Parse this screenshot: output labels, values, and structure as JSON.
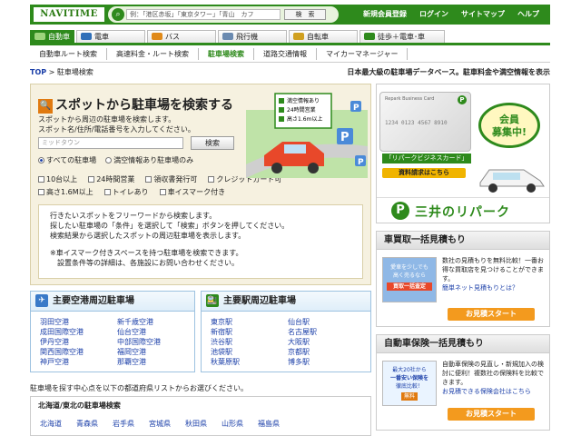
{
  "header": {
    "logo": "NAVITIME",
    "search_placeholder": "例：「港区赤坂」「東京タワー」「青山　カフ",
    "search_button": "検　索",
    "nav": [
      "新規会員登録",
      "ログイン",
      "サイトマップ",
      "ヘルプ"
    ]
  },
  "tabs": [
    {
      "label": "自動車",
      "active": true,
      "color": "#4a9a2a"
    },
    {
      "label": "電車",
      "active": false,
      "color": "#2f6fb8"
    },
    {
      "label": "バス",
      "active": false,
      "color": "#e08a1a"
    },
    {
      "label": "飛行機",
      "active": false,
      "color": "#6a8ab0"
    },
    {
      "label": "自転車",
      "active": false,
      "color": "#d0a020"
    },
    {
      "label": "徒歩＋電車･車",
      "active": false,
      "color": "#2e8a1c"
    }
  ],
  "subnav": [
    "自動車ルート検索",
    "高速料金・ルート検索",
    "駐車場検索",
    "道路交通情報",
    "マイカーマネージャー"
  ],
  "breadcrumb": {
    "top": "TOP",
    "current": "駐車場検索"
  },
  "tagline": "日本最大級の駐車場データベース。駐車料金や満空情報を表示",
  "search_panel": {
    "title": "スポットから駐車場を検索する",
    "desc_line1": "スポットから周辺の駐車場を検索します。",
    "desc_line2": "スポット名/住所/電話番号を入力してください。",
    "input_placeholder": "ミッドタウン",
    "button": "検索",
    "radio_all": "すべての駐車場",
    "radio_vacancy": "満空情報あり駐車場のみ",
    "checks_row1": [
      "10台以上",
      "24時間営業",
      "領収書発行可",
      "クレジットカード可"
    ],
    "checks_row2": [
      "高さ1.6M以上",
      "トイレあり",
      "車イスマーク付き"
    ],
    "legend": [
      "満空情報あり",
      "24時間営業",
      "高さ1.6m以上"
    ],
    "help_line1": "行きたいスポットをフリーワードから検索します。",
    "help_line2": "探したい駐車場の「条件」を選択して「検索」ボタンを押してください。",
    "help_line3": "検索結果から選択したスポットの周辺駐車場を表示します。",
    "help_line4": "※車イスマーク付きスペースを持つ駐車場を検索できます。",
    "help_line5": "設置条件等の詳細は、各施設にお問い合わせください。"
  },
  "ad_repark": {
    "card_text": "Repark Business Card",
    "card_number": "1234 0123 4567 8910",
    "card_label": "「リパークビジネスカード」",
    "request_button": "資料請求はこちら",
    "bubble_line1": "会員",
    "bubble_line2": "募集中!",
    "brand_name": "三井のリパーク"
  },
  "car_buy": {
    "title": "車買取一括見積もり",
    "text": "数社の見積もりを無料比較！一番お得な買取店を見つけることができます。",
    "link": "簡単ネット見積もりとは？",
    "thumb_line1": "愛車を少しでも",
    "thumb_line2": "高く売るなら",
    "thumb_line3": "買取一括査定",
    "button": "お見積スタート"
  },
  "car_insurance": {
    "title": "自動車保険一括見積もり",
    "text": "自動車保険の見直し・新規加入の検討に便利！複数社の保険料を比較できます。",
    "link": "お見積できる保険会社はこちら",
    "thumb_line1": "最大20社から",
    "thumb_line2": "一番安い保険を",
    "thumb_line3": "徹底比較！",
    "thumb_badge": "無料",
    "button": "お見積スタート"
  },
  "airports": {
    "title": "主要空港周辺駐車場",
    "items": [
      "羽田空港",
      "新千歳空港",
      "成田国際空港",
      "仙台空港",
      "伊丹空港",
      "中部国際空港",
      "関西国際空港",
      "福岡空港",
      "神戸空港",
      "那覇空港"
    ]
  },
  "stations": {
    "title": "主要駅周辺駐車場",
    "items": [
      "東京駅",
      "仙台駅",
      "新宿駅",
      "名古屋駅",
      "渋谷駅",
      "大阪駅",
      "池袋駅",
      "京都駅",
      "秋葉原駅",
      "博多駅"
    ]
  },
  "region_note": "駐車場を探す中心点を以下の都道府県リストからお選びください。",
  "region": {
    "title": "北海道/東北の駐車場検索",
    "prefectures": [
      "北海道",
      "青森県",
      "岩手県",
      "宮城県",
      "秋田県",
      "山形県",
      "福島県"
    ]
  },
  "colors": {
    "brand_green": "#2e8a1c",
    "link_blue": "#1a3ea8",
    "orange": "#f39a1e"
  }
}
